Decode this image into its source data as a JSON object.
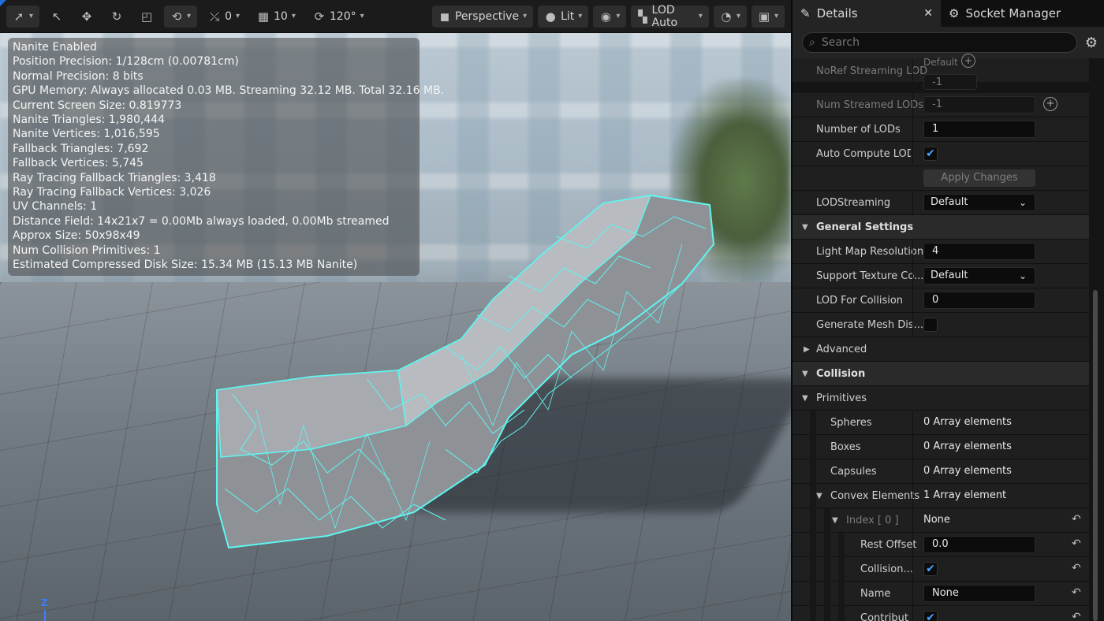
{
  "toolbar": {
    "snap_rotation": "0",
    "grid_size": "10",
    "rotation_angle": "120°",
    "view_mode": "Perspective",
    "lighting": "Lit",
    "lod": "LOD Auto"
  },
  "stats": [
    "Nanite Enabled",
    "Position Precision: 1/128cm (0.00781cm)",
    "Normal Precision: 8 bits",
    "GPU Memory: Always allocated 0.03 MB. Streaming 32.12 MB. Total 32.16 MB.",
    "Current Screen Size: 0.819773",
    "Nanite Triangles: 1,980,444",
    "Nanite Vertices: 1,016,595",
    "Fallback Triangles: 7,692",
    "Fallback Vertices: 5,745",
    "Ray Tracing Fallback Triangles: 3,418",
    "Ray Tracing Fallback Vertices: 3,026",
    "UV Channels: 1",
    "Distance Field: 14x21x7 = 0.00Mb always loaded, 0.00Mb streamed",
    "Approx Size: 50x98x49",
    "Num Collision Primitives: 1",
    "Estimated Compressed Disk Size: 15.34 MB (15.13 MB Nanite)"
  ],
  "axis_label": "Z",
  "panel": {
    "tab_details": "Details",
    "tab_socket_manager": "Socket Manager",
    "search_placeholder": "Search",
    "rows": {
      "noref_default": "Default",
      "noref_label": "NoRef Streaming LOD",
      "noref_value": "-1",
      "num_streamed_label": "Num Streamed LODs",
      "num_streamed_value": "-1",
      "num_lods_label": "Number of LODs",
      "num_lods_value": "1",
      "auto_compute_label": "Auto Compute LOD D",
      "apply_changes": "Apply Changes",
      "lod_streaming_label": "LODStreaming",
      "lod_streaming_value": "Default",
      "general_settings": "General Settings",
      "light_map_label": "Light Map Resolution",
      "light_map_value": "4",
      "support_texture_label": "Support Texture Co...",
      "support_texture_value": "Default",
      "lod_collision_label": "LOD For Collision",
      "lod_collision_value": "0",
      "generate_mesh_label": "Generate Mesh Dis...",
      "advanced": "Advanced",
      "collision": "Collision",
      "primitives": "Primitives",
      "spheres_label": "Spheres",
      "spheres_value": "0 Array elements",
      "boxes_label": "Boxes",
      "boxes_value": "0 Array elements",
      "capsules_label": "Capsules",
      "capsules_value": "0 Array elements",
      "convex_label": "Convex Elements",
      "convex_value": "1 Array element",
      "index_label": "Index [ 0 ]",
      "index_value": "None",
      "rest_offset_label": "Rest Offset",
      "rest_offset_value": "0.0",
      "collision_label": "Collision...",
      "name_label": "Name",
      "name_value": "None",
      "contribut_label": "Contribut"
    }
  }
}
